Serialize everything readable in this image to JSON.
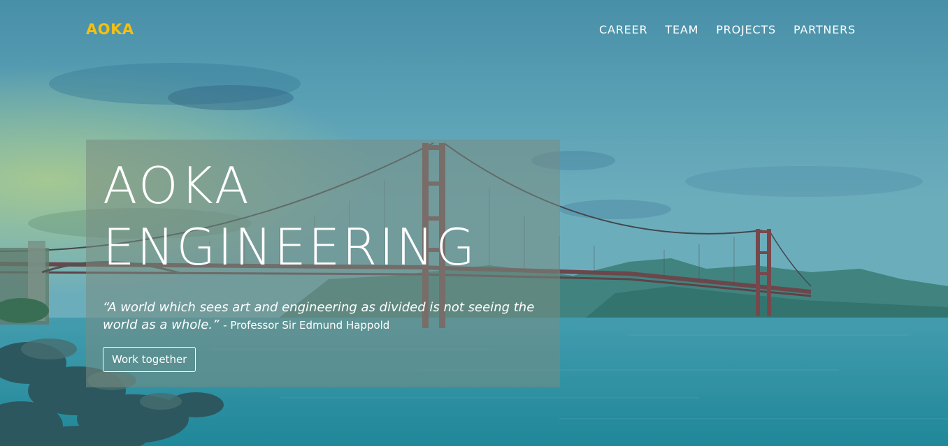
{
  "brand": {
    "name": "AOKA",
    "color": "#f3c013"
  },
  "nav": {
    "items": [
      {
        "label": "CAREER"
      },
      {
        "label": "TEAM"
      },
      {
        "label": "PROJECTS"
      },
      {
        "label": "PARTNERS"
      }
    ]
  },
  "hero": {
    "title_line1": "AOKA",
    "title_line2": "ENGINEERING",
    "quote": "“A world which sees art and engineering as divided is not seeing the world as a whole.”",
    "author": "- Professor Sir Edmund Happold",
    "cta_label": "Work together",
    "background_image": "golden-gate-bridge-photo"
  },
  "colors": {
    "accent": "#f3c013",
    "text": "#ffffff"
  }
}
